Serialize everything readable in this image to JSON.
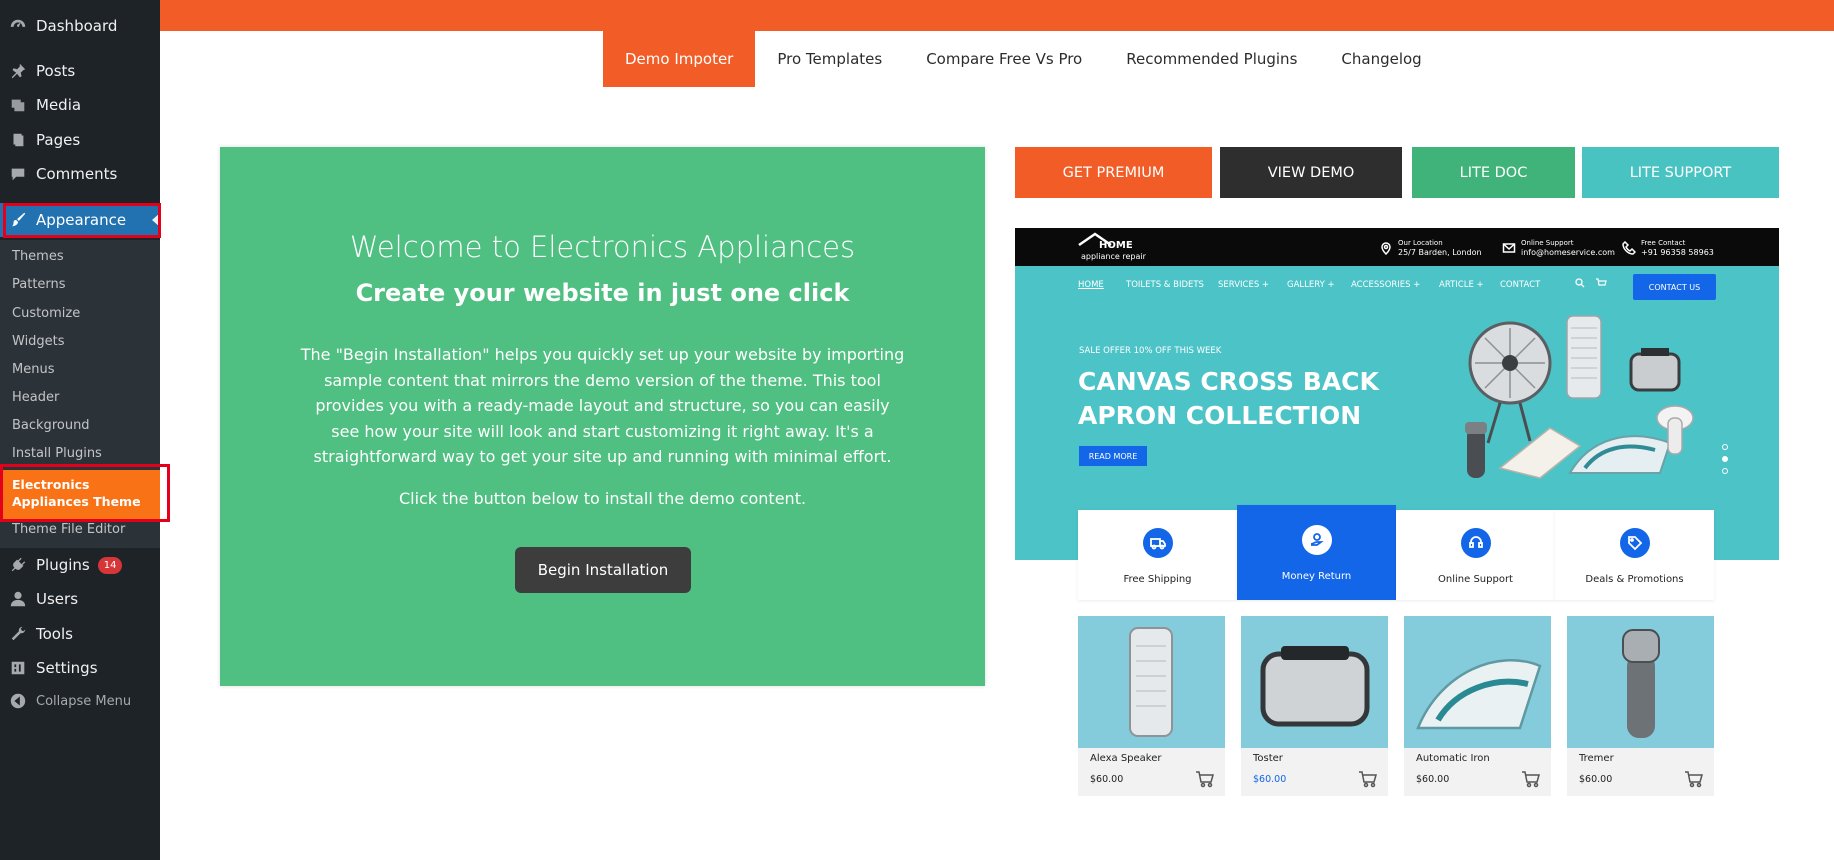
{
  "sidebar": {
    "dashboard": "Dashboard",
    "posts": "Posts",
    "media": "Media",
    "pages": "Pages",
    "comments": "Comments",
    "appearance": "Appearance",
    "submenu": [
      "Themes",
      "Patterns",
      "Customize",
      "Widgets",
      "Menus",
      "Header",
      "Background",
      "Install Plugins"
    ],
    "current_line1": "Electronics",
    "current_line2": "Appliances Theme",
    "theme_file_editor": "Theme File Editor",
    "plugins": "Plugins",
    "plugins_badge": "14",
    "users": "Users",
    "tools": "Tools",
    "settings": "Settings",
    "collapse": "Collapse Menu"
  },
  "tabs": [
    "Demo Impoter",
    "Pro Templates",
    "Compare Free Vs Pro",
    "Recommended Plugins",
    "Changelog"
  ],
  "panel": {
    "welcome": "Welcome to Electronics Appliances",
    "subtitle": "Create your website in just one click",
    "description": "The \"Begin Installation\" helps you quickly set up your website by importing sample content that mirrors the demo version of the theme. This tool provides you with a ready-made layout and structure, so you can easily see how your site will look and start customizing it right away. It's a straightforward way to get your site up and running with minimal effort.",
    "note": "Click the button below to install the demo content.",
    "button": "Begin Installation"
  },
  "actions": {
    "get_premium": "GET PREMIUM",
    "view_demo": "VIEW DEMO",
    "lite_doc": "LITE DOC",
    "lite_support": "LITE SUPPORT"
  },
  "colors": {
    "brand_orange": "#f25c27",
    "panel_green": "#4fbf82",
    "wp_blue": "#2271b1",
    "preview_blue": "#1366e8",
    "preview_teal": "#4cc3c7"
  },
  "preview": {
    "logo_word": "HOME",
    "logo_sub": "appliance repair",
    "location_label": "Our Location",
    "location_value": "25/7 Barden, London",
    "support_label": "Online Support",
    "support_value": "info@homeservice.com",
    "contact_label": "Free Contact",
    "contact_value": "+91 96358 58963",
    "nav": [
      "HOME",
      "TOILETS & BIDETS",
      "SERVICES +",
      "GALLERY +",
      "ACCESSORIES +",
      "ARTICLE +",
      "CONTACT"
    ],
    "contact_button": "CONTACT US",
    "offer": "SALE OFFER 10% OFF THIS WEEK",
    "title": "CANVAS CROSS BACK APRON COLLECTION",
    "read_more": "READ MORE",
    "features": [
      "Free Shipping",
      "Money Return",
      "Online Support",
      "Deals & Promotions"
    ],
    "products": [
      {
        "name": "Alexa Speaker",
        "price": "$60.00"
      },
      {
        "name": "Toster",
        "price": "$60.00"
      },
      {
        "name": "Automatic Iron",
        "price": "$60.00"
      },
      {
        "name": "Tremer",
        "price": "$60.00"
      }
    ]
  }
}
